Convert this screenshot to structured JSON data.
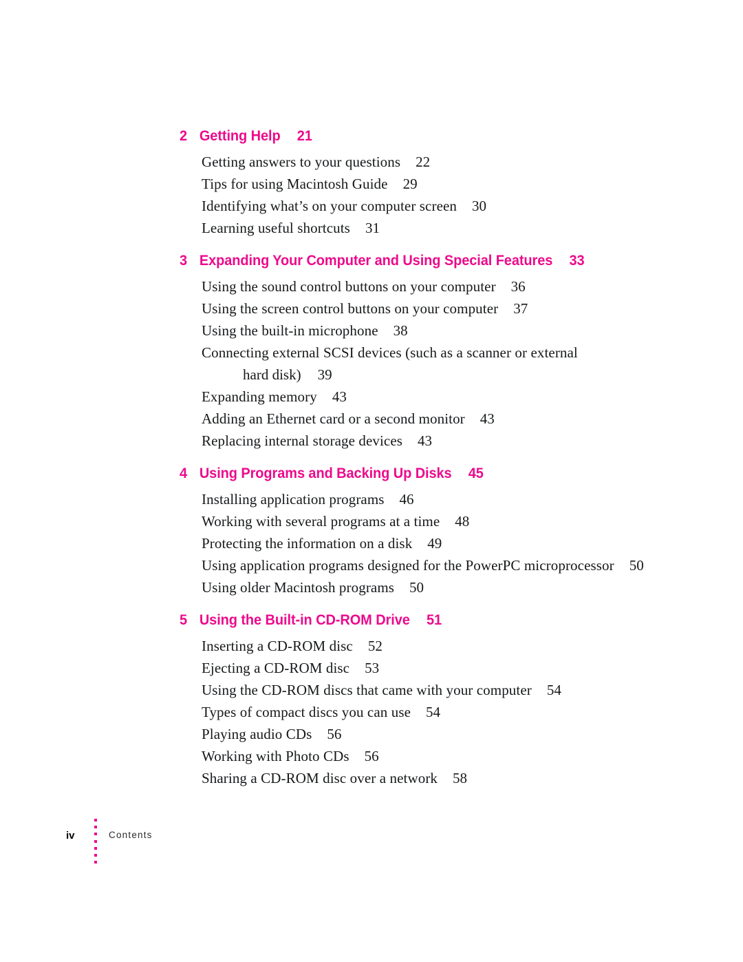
{
  "document": {
    "section_title": "Contents",
    "folio": "iv",
    "accent_color": "#EC0A8C",
    "text_color": "#16181a"
  },
  "toc": {
    "chapters": [
      {
        "number": "2",
        "title": "Getting Help",
        "page": "21",
        "entries": [
          {
            "text": "Getting answers to your questions",
            "page": "22"
          },
          {
            "text": "Tips for using Macintosh Guide",
            "page": "29"
          },
          {
            "text": "Identifying what’s on your computer screen",
            "page": "30"
          },
          {
            "text": "Learning useful shortcuts",
            "page": "31"
          }
        ]
      },
      {
        "number": "3",
        "title": "Expanding Your Computer and Using Special Features",
        "page": "33",
        "entries": [
          {
            "text": "Using the sound control buttons on your computer",
            "page": "36"
          },
          {
            "text": "Using the screen control buttons on your computer",
            "page": "37"
          },
          {
            "text": "Using the built-in microphone",
            "page": "38"
          },
          {
            "text": "Connecting external SCSI devices (such as a scanner or external",
            "continuation": "hard disk)",
            "page": "39"
          },
          {
            "text": "Expanding memory",
            "page": "43"
          },
          {
            "text": "Adding an Ethernet card or a second monitor",
            "page": "43"
          },
          {
            "text": "Replacing internal storage devices",
            "page": "43"
          }
        ]
      },
      {
        "number": "4",
        "title": "Using Programs and Backing Up Disks",
        "page": "45",
        "entries": [
          {
            "text": "Installing application programs",
            "page": "46"
          },
          {
            "text": "Working with several programs at a time",
            "page": "48"
          },
          {
            "text": "Protecting the information on a disk",
            "page": "49"
          },
          {
            "text": "Using application programs designed for the PowerPC microprocessor",
            "page": "50"
          },
          {
            "text": "Using older Macintosh programs",
            "page": "50"
          }
        ]
      },
      {
        "number": "5",
        "title": "Using the Built-in CD-ROM Drive",
        "page": "51",
        "entries": [
          {
            "text": "Inserting a CD-ROM disc",
            "page": "52"
          },
          {
            "text": "Ejecting a CD-ROM disc",
            "page": "53"
          },
          {
            "text": "Using the CD-ROM discs that came with your computer",
            "page": "54"
          },
          {
            "text": "Types of compact discs you can use",
            "page": "54"
          },
          {
            "text": "Playing audio CDs",
            "page": "56"
          },
          {
            "text": "Working with Photo CDs",
            "page": "56"
          },
          {
            "text": "Sharing a CD-ROM disc over a network",
            "page": "58"
          }
        ]
      }
    ]
  }
}
